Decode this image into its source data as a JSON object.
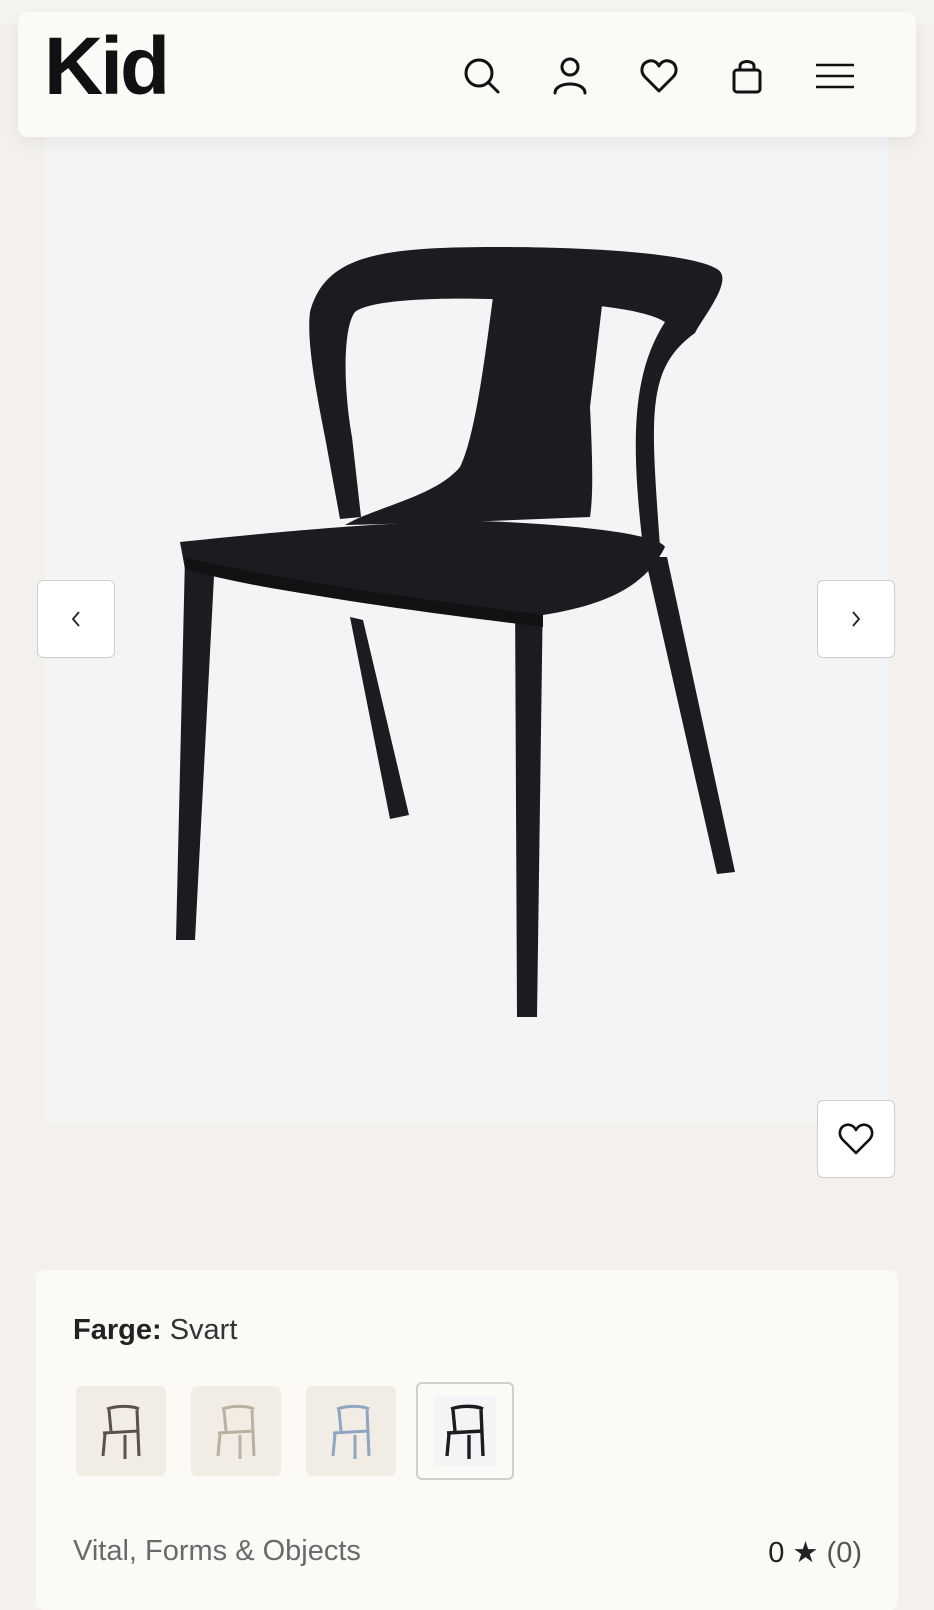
{
  "header": {
    "logo": "Kid",
    "icons": [
      "search-icon",
      "user-icon",
      "heart-icon",
      "bag-icon",
      "menu-icon"
    ]
  },
  "gallery": {
    "prev_icon": "chevron-left-icon",
    "next_icon": "chevron-right-icon",
    "favorite_icon": "heart-icon"
  },
  "product": {
    "color_label": "Farge:",
    "color_value": "Svart",
    "swatches": [
      {
        "color": "#5b5148"
      },
      {
        "color": "#b9b29f"
      },
      {
        "color": "#8ea6c4"
      },
      {
        "color": "#1b1c1f",
        "selected": true
      }
    ],
    "brand": "Vital, Forms & Objects",
    "rating_value": "0",
    "rating_star": "★",
    "rating_count": "(0)"
  }
}
